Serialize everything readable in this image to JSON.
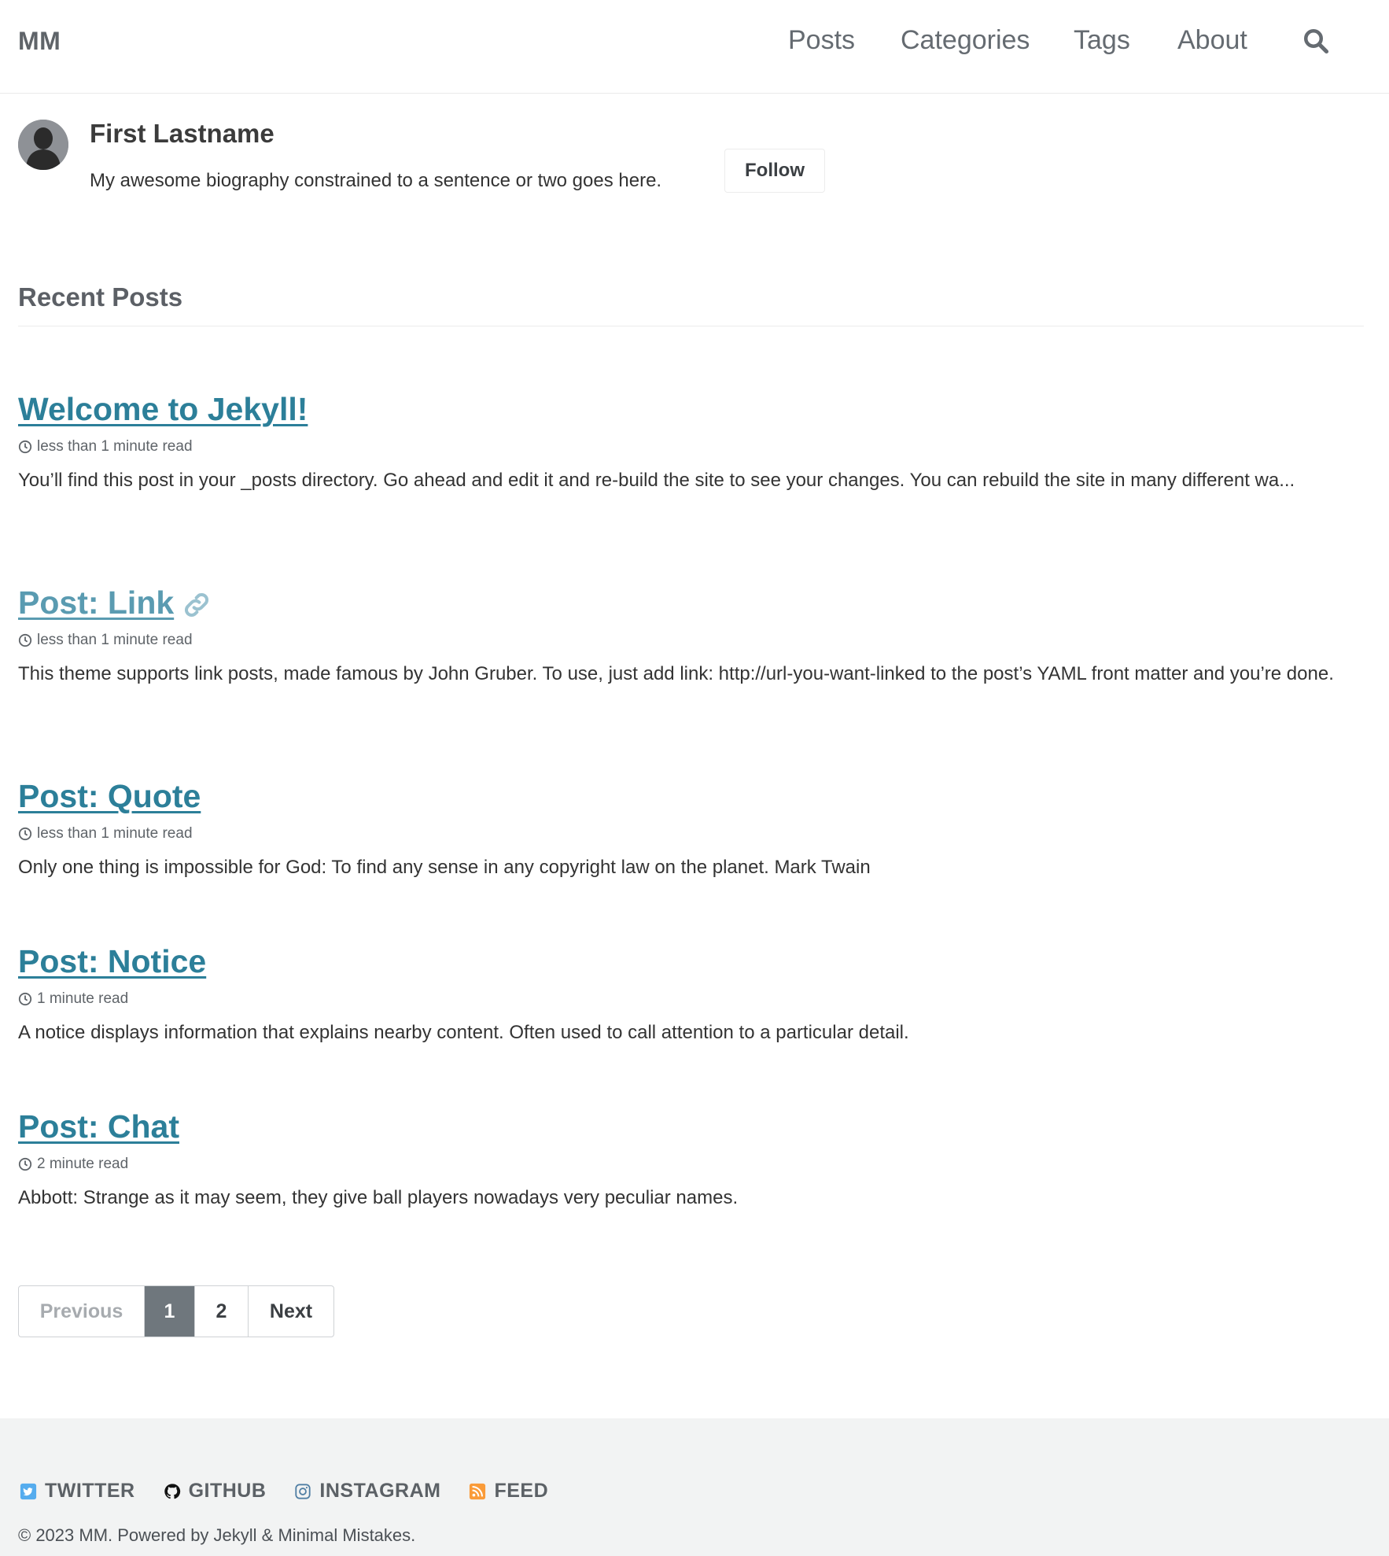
{
  "masthead": {
    "site_title": "MM",
    "nav": [
      {
        "label": "Posts"
      },
      {
        "label": "Categories"
      },
      {
        "label": "Tags"
      },
      {
        "label": "About"
      }
    ],
    "search_icon": "search-icon"
  },
  "author": {
    "name": "First Lastname",
    "bio": "My awesome biography constrained to a sentence or two goes here.",
    "follow_label": "Follow",
    "avatar_icon": "person-silhouette"
  },
  "recent_posts": {
    "title": "Recent Posts",
    "posts": [
      {
        "title": "Welcome to Jekyll!",
        "read_time": "less than 1 minute read",
        "excerpt": "You’ll find this post in your _posts directory. Go ahead and edit it and re-build the site to see your changes. You can rebuild the site in many different wa..."
      },
      {
        "title": "Post: Link",
        "read_time": "less than 1 minute read",
        "excerpt": "This theme supports link posts, made famous by John Gruber. To use, just add link: http://url-you-want-linked to the post’s YAML front matter and you’re done."
      },
      {
        "title": "Post: Quote",
        "read_time": "less than 1 minute read",
        "excerpt": "Only one thing is impossible for God: To find any sense in any copyright law on the planet. Mark Twain"
      },
      {
        "title": "Post: Notice",
        "read_time": "1 minute read",
        "excerpt": "A notice displays information that explains nearby content. Often used to call attention to a particular detail."
      },
      {
        "title": "Post: Chat",
        "read_time": "2 minute read",
        "excerpt": "Abbott: Strange as it may seem, they give ball players nowadays very peculiar names."
      }
    ]
  },
  "pagination": {
    "previous": "Previous",
    "pages": [
      "1",
      "2"
    ],
    "current": "1",
    "next": "Next"
  },
  "footer": {
    "links": [
      {
        "label": "TWITTER",
        "icon": "twitter-icon",
        "color": "#55acee"
      },
      {
        "label": "GITHUB",
        "icon": "github-icon",
        "color": "#000000"
      },
      {
        "label": "INSTAGRAM",
        "icon": "instagram-icon",
        "color": "#517fa4"
      },
      {
        "label": "FEED",
        "icon": "rss-icon",
        "color": "#fa9b39"
      }
    ],
    "copyright": "© 2023 MM. Powered by Jekyll & Minimal Mistakes."
  },
  "colors": {
    "link": "#2c7f99",
    "current_page_bg": "#6f777d",
    "footer_bg": "#f2f3f3"
  }
}
